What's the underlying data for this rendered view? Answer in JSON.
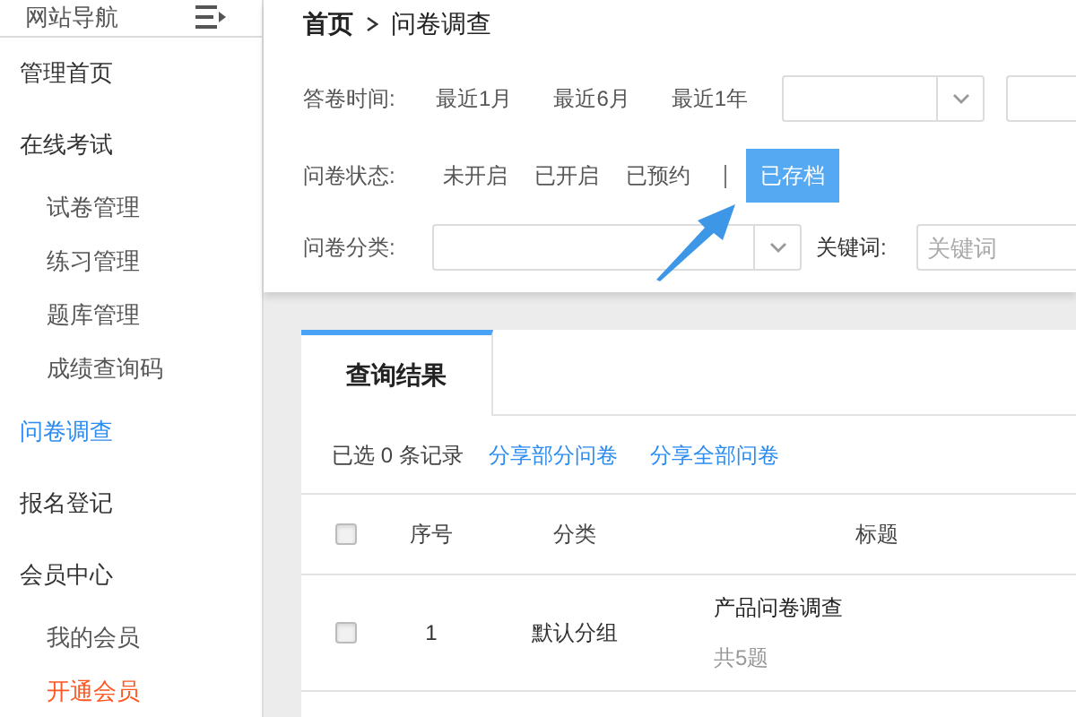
{
  "sidebar": {
    "title": "网站导航",
    "items": [
      {
        "label": "管理首页",
        "selected": false
      },
      {
        "label": "在线考试",
        "selected": false,
        "children": [
          {
            "label": "试卷管理",
            "selected": false
          },
          {
            "label": "练习管理",
            "selected": false
          },
          {
            "label": "题库管理",
            "selected": false
          },
          {
            "label": "成绩查询码",
            "selected": false
          }
        ]
      },
      {
        "label": "问卷调查",
        "selected": true
      },
      {
        "label": "报名登记",
        "selected": false
      },
      {
        "label": "会员中心",
        "selected": false,
        "children": [
          {
            "label": "我的会员",
            "selected": false
          },
          {
            "label": "开通会员",
            "selected": false,
            "color": "#ff5722"
          }
        ]
      }
    ]
  },
  "breadcrumb": [
    "首页",
    "问卷调查"
  ],
  "filters": {
    "time": {
      "label": "答卷时间:",
      "options": [
        {
          "label": "最近1月",
          "selected": false
        },
        {
          "label": "最近6月",
          "selected": false
        },
        {
          "label": "最近1年",
          "selected": false
        }
      ]
    },
    "status": {
      "label": "问卷状态:",
      "options": [
        {
          "label": "未开启",
          "selected": false
        },
        {
          "label": "已开启",
          "selected": false
        },
        {
          "label": "已预约",
          "selected": false
        },
        {
          "label": "已存档",
          "selected": true
        }
      ]
    },
    "category": {
      "label": "问卷分类:"
    },
    "keyword": {
      "label": "关键词:",
      "placeholder": "关键词"
    }
  },
  "results": {
    "tab": "查询结果",
    "selection_note": "已选 0 条记录",
    "actions": [
      "分享部分问卷",
      "分享全部问卷"
    ],
    "select_all_checked": false,
    "columns": [
      "序号",
      "分类",
      "标题"
    ],
    "rows": [
      {
        "checked": false,
        "number": "1",
        "category": "默认分组",
        "title": "产品问卷调查",
        "subtitle": "共5题"
      }
    ]
  }
}
